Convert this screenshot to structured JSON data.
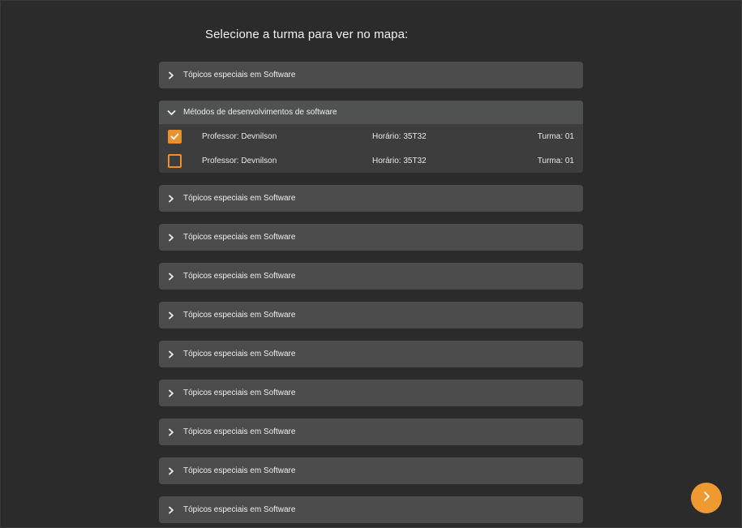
{
  "page": {
    "title": "Selecione a turma para ver no mapa:"
  },
  "accordions": [
    {
      "title": "Tópicos especiais em Software",
      "open": false
    },
    {
      "title": "Métodos de desenvolvimentos de software",
      "open": true,
      "rows": [
        {
          "checked": true,
          "professor": "Professor: Devnilson",
          "horario": "Horário: 35T32",
          "turma": "Turma: 01"
        },
        {
          "checked": false,
          "professor": "Professor: Devnilson",
          "horario": "Horário: 35T32",
          "turma": "Turma: 01"
        }
      ]
    },
    {
      "title": "Tópicos especiais em Software",
      "open": false
    },
    {
      "title": "Tópicos especiais em Software",
      "open": false
    },
    {
      "title": "Tópicos especiais em Software",
      "open": false
    },
    {
      "title": "Tópicos especiais em Software",
      "open": false
    },
    {
      "title": "Tópicos especiais em Software",
      "open": false
    },
    {
      "title": "Tópicos especiais em Software",
      "open": false
    },
    {
      "title": "Tópicos especiais em Software",
      "open": false
    },
    {
      "title": "Tópicos especiais em Software",
      "open": false
    },
    {
      "title": "Tópicos especiais em Software",
      "open": false
    }
  ],
  "icons": {
    "collapsed": "chevron-right-icon",
    "expanded": "chevron-down-icon",
    "checked": "checkmark-icon",
    "next": "chevron-right-icon"
  },
  "colors": {
    "background": "#2b2b2b",
    "card": "#4b4c4b",
    "expanded_body": "#3d3d3d",
    "accent": "#ee9a30"
  }
}
